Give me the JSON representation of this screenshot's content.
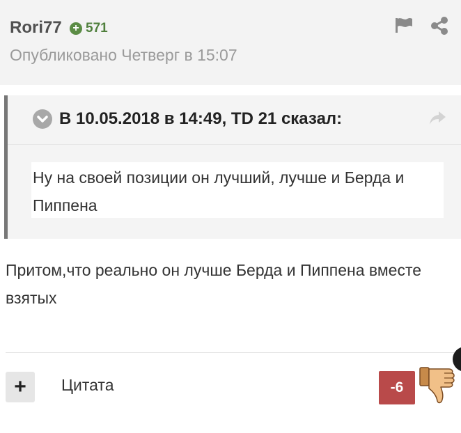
{
  "post": {
    "author": "Rori77",
    "reputation": "571",
    "published": "Опубликовано Четверг в 15:07"
  },
  "quote": {
    "citation": "В 10.05.2018 в 14:49, TD 21 сказал:",
    "text": "Ну на своей позиции он лучший, лучше и Берда и Пиппена"
  },
  "content": {
    "text": "Притом,что реально он лучше Берда и Пиппена вместе взятых"
  },
  "footer": {
    "plus_label": "+",
    "quote_label": "Цитата",
    "score": "-6"
  },
  "icons": {
    "report": "flag-icon",
    "share": "share-icon",
    "collapse": "chevron-down-icon",
    "go_to_quote": "share-arrow-icon",
    "vote_down": "thumbs-down-icon"
  },
  "colors": {
    "reputation": "#4f7f3c",
    "score_negative": "#b94a4a",
    "header_bg": "#f3f3f3"
  }
}
